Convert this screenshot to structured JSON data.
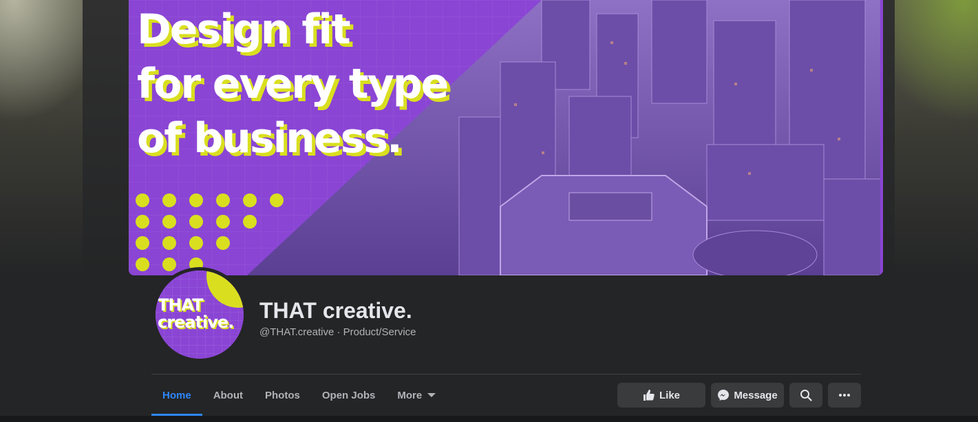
{
  "cover": {
    "headline_lines": [
      "Design fit",
      "for every type",
      "of business."
    ],
    "colors": {
      "purple": "#8a45d4",
      "accent_yellow": "#d9df1f"
    }
  },
  "profile": {
    "logo_lines": [
      "THAT",
      "creative."
    ],
    "name": "THAT creative.",
    "subtitle": "@THAT.creative · Product/Service"
  },
  "tabs": [
    {
      "label": "Home",
      "active": true
    },
    {
      "label": "About",
      "active": false
    },
    {
      "label": "Photos",
      "active": false
    },
    {
      "label": "Open Jobs",
      "active": false
    },
    {
      "label": "More",
      "active": false,
      "has_dropdown": true
    }
  ],
  "actions": {
    "like_label": "Like",
    "message_label": "Message",
    "icons": [
      "thumbs-up-icon",
      "messenger-icon",
      "search-icon",
      "ellipsis-icon"
    ]
  },
  "theme": {
    "background": "#242526",
    "button_bg": "#3a3b3c",
    "active_tab": "#2d88ff",
    "text": "#e4e6eb",
    "muted_text": "#b0b3b8"
  }
}
